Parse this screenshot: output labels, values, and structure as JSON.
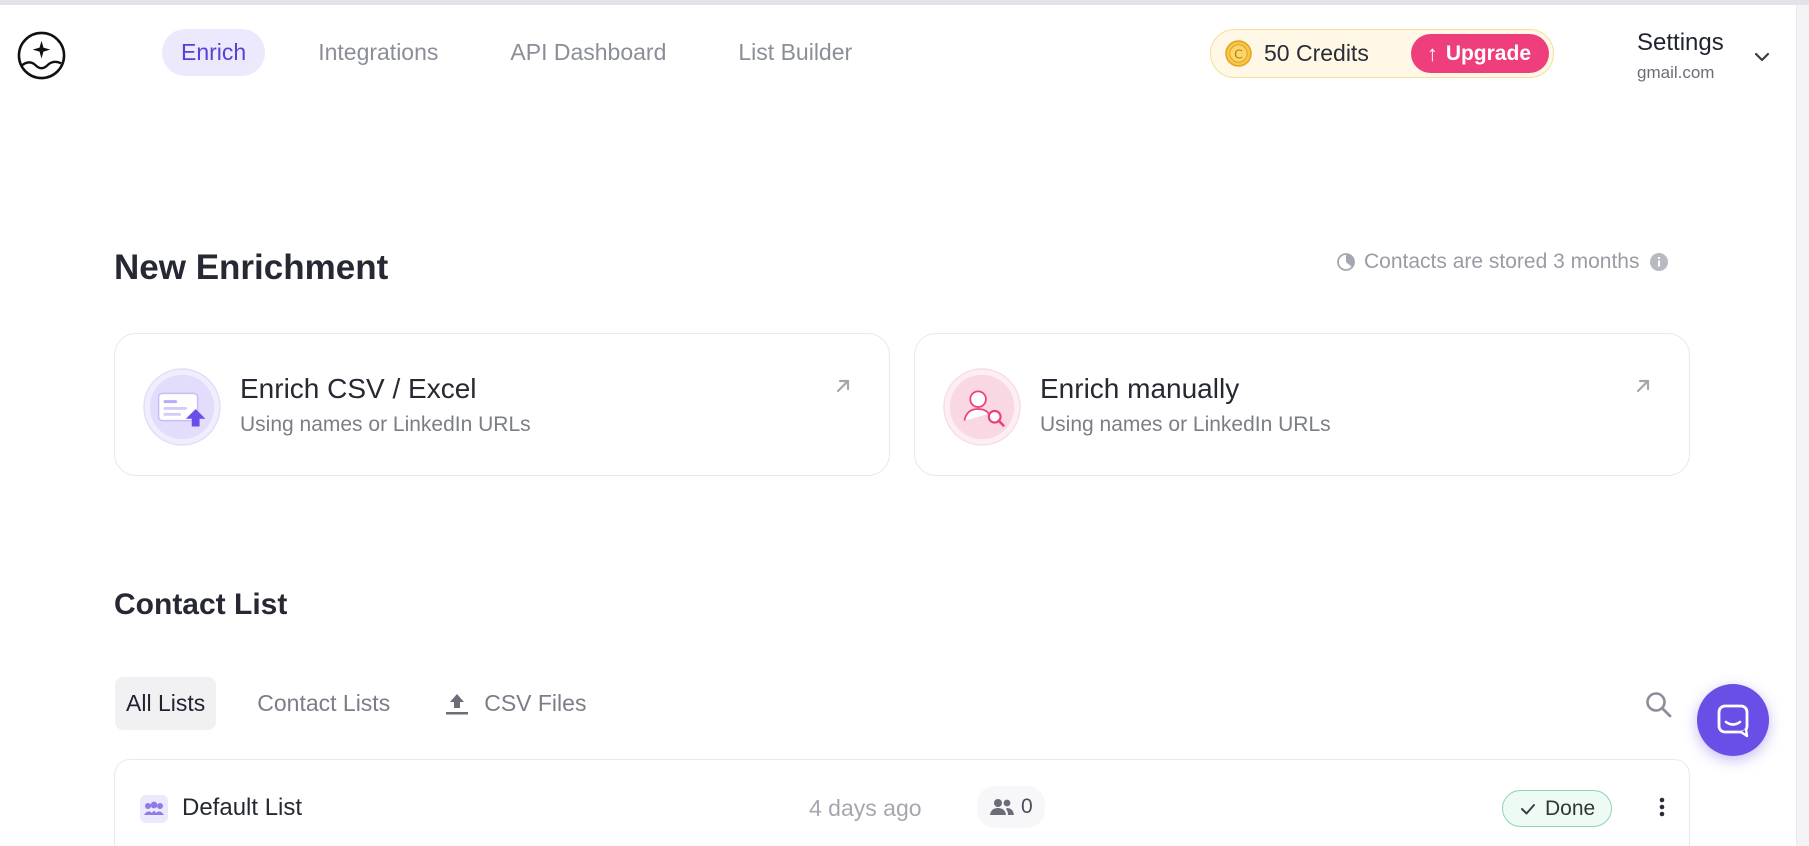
{
  "nav": {
    "items": [
      {
        "label": "Enrich",
        "active": true
      },
      {
        "label": "Integrations",
        "active": false
      },
      {
        "label": "API Dashboard",
        "active": false
      },
      {
        "label": "List Builder",
        "active": false
      }
    ]
  },
  "credits": {
    "coin_letter": "C",
    "label": "50 Credits",
    "upgrade_label": "Upgrade"
  },
  "account": {
    "name": "Settings",
    "email": "gmail.com"
  },
  "enrichment": {
    "title": "New Enrichment",
    "storage_note": "Contacts are stored 3 months",
    "cards": [
      {
        "title": "Enrich CSV / Excel",
        "subtitle": "Using names or LinkedIn URLs",
        "icon": "csv-upload-icon"
      },
      {
        "title": "Enrich manually",
        "subtitle": "Using names or LinkedIn URLs",
        "icon": "manual-search-icon"
      }
    ]
  },
  "contact_list": {
    "title": "Contact List",
    "tabs": [
      {
        "label": "All Lists",
        "active": true
      },
      {
        "label": "Contact Lists",
        "active": false
      },
      {
        "label": "CSV Files",
        "active": false,
        "icon": "upload-icon"
      }
    ],
    "rows": [
      {
        "name": "Default List",
        "time": "4 days ago",
        "count": "0",
        "status": "Done"
      }
    ]
  },
  "colors": {
    "accent": "#5b3fd4",
    "upgrade": "#ee3e7b",
    "chat": "#6a4ee6",
    "done_border": "#8fd4b4"
  }
}
